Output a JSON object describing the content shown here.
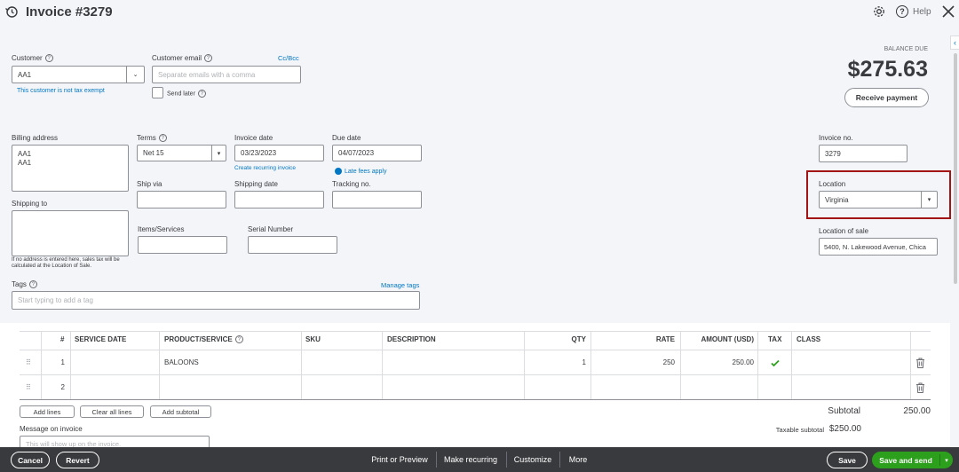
{
  "header": {
    "title": "Invoice #3279",
    "help_label": "Help"
  },
  "balance": {
    "label": "BALANCE DUE",
    "amount": "$275.63",
    "receive_payment": "Receive payment"
  },
  "customer": {
    "label": "Customer",
    "value": "AA1",
    "tax_note": "This customer is not tax exempt"
  },
  "email": {
    "label": "Customer email",
    "placeholder": "Separate emails with a comma",
    "ccbcc": "Cc/Bcc",
    "send_later": "Send later"
  },
  "billing": {
    "label": "Billing address",
    "line1": "AA1",
    "line2": "AA1"
  },
  "shipping": {
    "label": "Shipping to",
    "note": "If no address is entered here, sales tax will be calculated at the Location of Sale."
  },
  "terms": {
    "label": "Terms",
    "value": "Net 15"
  },
  "invoice_date": {
    "label": "Invoice date",
    "value": "03/23/2023",
    "recurring_link": "Create recurring invoice"
  },
  "due_date": {
    "label": "Due date",
    "value": "04/07/2023",
    "late_fees": "Late fees apply"
  },
  "ship_via": {
    "label": "Ship via"
  },
  "shipping_date": {
    "label": "Shipping date"
  },
  "tracking": {
    "label": "Tracking no."
  },
  "items_services": {
    "label": "Items/Services"
  },
  "serial": {
    "label": "Serial Number"
  },
  "invoice_no": {
    "label": "Invoice no.",
    "value": "3279"
  },
  "location": {
    "label": "Location",
    "value": "Virginia"
  },
  "location_of_sale": {
    "label": "Location of sale",
    "value": "5400, N. Lakewood Avenue, Chica"
  },
  "tags": {
    "label": "Tags",
    "manage": "Manage tags",
    "placeholder": "Start typing to add a tag"
  },
  "table": {
    "headers": {
      "num": "#",
      "service_date": "SERVICE DATE",
      "product": "PRODUCT/SERVICE",
      "sku": "SKU",
      "description": "DESCRIPTION",
      "qty": "QTY",
      "rate": "RATE",
      "amount": "AMOUNT (USD)",
      "tax": "TAX",
      "class": "CLASS"
    },
    "rows": [
      {
        "num": "1",
        "product": "BALOONS",
        "qty": "1",
        "rate": "250",
        "amount": "250.00"
      },
      {
        "num": "2",
        "product": "",
        "qty": "",
        "rate": "",
        "amount": ""
      }
    ]
  },
  "actions": {
    "add_lines": "Add lines",
    "clear_lines": "Clear all lines",
    "add_subtotal": "Add subtotal"
  },
  "totals": {
    "subtotal_label": "Subtotal",
    "subtotal_value": "250.00",
    "taxable_label": "Taxable subtotal",
    "taxable_value": "$250.00"
  },
  "message": {
    "label": "Message on invoice",
    "placeholder": "This will show up on the invoice."
  },
  "footer": {
    "cancel": "Cancel",
    "revert": "Revert",
    "print": "Print or Preview",
    "recurring": "Make recurring",
    "customize": "Customize",
    "more": "More",
    "save": "Save",
    "save_send": "Save and send"
  },
  "colors": {
    "accent": "#0077c5",
    "primary_green": "#2ca01c",
    "footer_bg": "#393a3d",
    "highlight": "#a31515"
  }
}
